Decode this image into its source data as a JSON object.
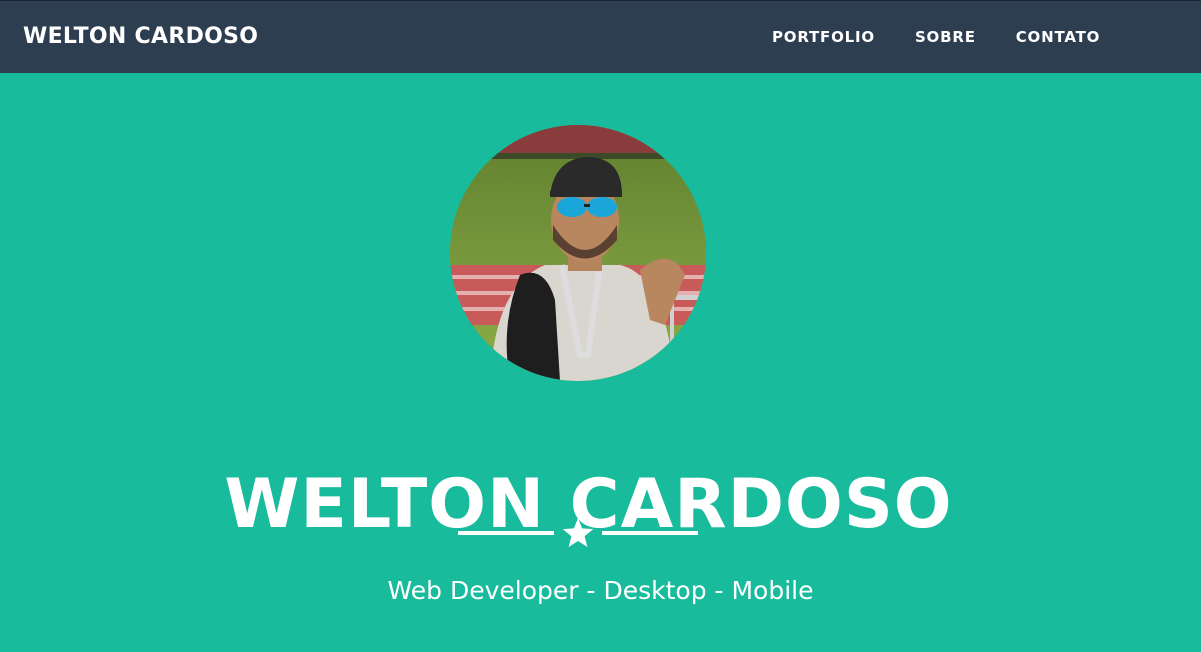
{
  "navbar": {
    "brand": "WELTON CARDOSO",
    "links": [
      {
        "label": "PORTFOLIO"
      },
      {
        "label": "SOBRE"
      },
      {
        "label": "CONTATO"
      }
    ]
  },
  "header": {
    "name": "WELTON CARDOSO",
    "divider_icon": "star-icon",
    "subtitle": "Web Developer - Desktop - Mobile",
    "profile_photo": "profile-photo"
  },
  "colors": {
    "navbar_bg": "#2c3e50",
    "header_bg": "#18bc9c",
    "text": "#ffffff"
  }
}
